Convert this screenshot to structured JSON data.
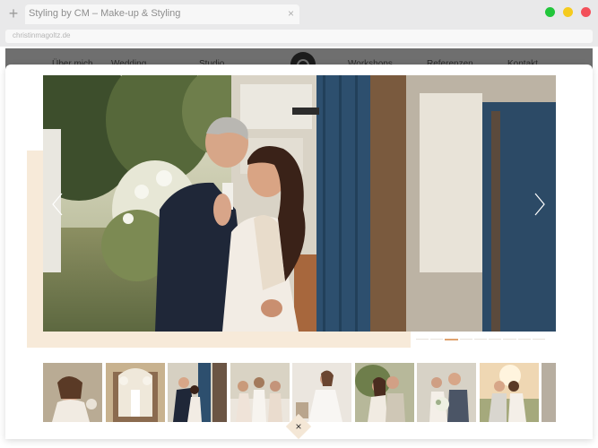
{
  "browser": {
    "new_tab_symbol": "+",
    "tab_title": "Styling by CM – Make-up & Styling",
    "tab_close_symbol": "×",
    "address": "christinmagoltz.de",
    "window_dots": [
      "#22c63b",
      "#f5cb1e",
      "#f3505a"
    ]
  },
  "nav": {
    "items": [
      "Über mich",
      "Wedding",
      "Studio",
      "Workshops",
      "Referenzen",
      "Kontakt"
    ],
    "logo_icon": "brand-logo-icon"
  },
  "lightbox": {
    "main_image": "wedding-couple-embrace-photo",
    "prev_icon": "chevron-left-icon",
    "next_icon": "chevron-right-icon",
    "close_symbol": "×",
    "slide_count": 9,
    "active_slide": 3,
    "accent_color": "#e0a36f",
    "panel_accent": "#f7ead9",
    "thumbnails": [
      "bride-portrait-thumb",
      "ceremony-arch-thumb",
      "couple-blue-door-thumb",
      "bridesmaids-thumb",
      "bride-getting-ready-thumb",
      "couple-smiling-thumb",
      "bride-bouquet-thumb",
      "couple-sunset-thumb",
      "partial-thumb"
    ]
  }
}
